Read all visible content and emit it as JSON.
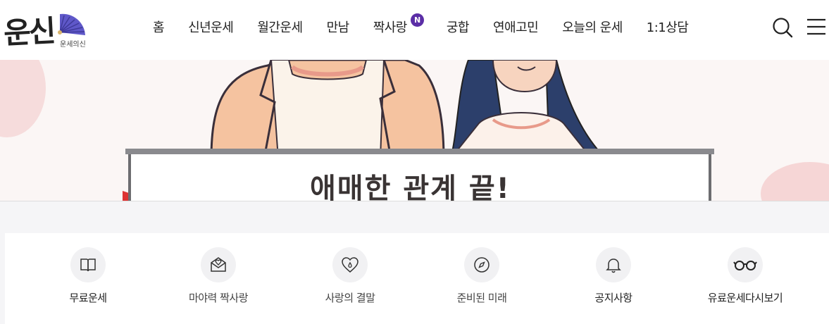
{
  "logo": {
    "main": "운신",
    "sub": "운세의신"
  },
  "nav": {
    "items": [
      {
        "label": "홈"
      },
      {
        "label": "신년운세"
      },
      {
        "label": "월간운세"
      },
      {
        "label": "만남"
      },
      {
        "label": "짝사랑",
        "badge": "N"
      },
      {
        "label": "궁합"
      },
      {
        "label": "연애고민"
      },
      {
        "label": "오늘의 운세"
      },
      {
        "label": "1:1상담"
      }
    ]
  },
  "header": {
    "search_icon": "search-icon",
    "menu_icon": "hamburger-menu-icon"
  },
  "banner": {
    "title": "애매한 관계 끝!"
  },
  "quick_menu": {
    "items": [
      {
        "label": "무료운세",
        "icon": "book-icon"
      },
      {
        "label": "마야력 짝사랑",
        "icon": "love-letter-icon"
      },
      {
        "label": "사랑의 결말",
        "icon": "heart-drop-icon"
      },
      {
        "label": "준비된 미래",
        "icon": "compass-icon"
      },
      {
        "label": "공지사항",
        "icon": "bell-icon"
      },
      {
        "label": "유료운세다시보기",
        "icon": "glasses-icon"
      }
    ]
  },
  "colors": {
    "badge": "#5b2ea6",
    "icon_bg": "#f1f1f3",
    "banner_bg": "#fbf6f5",
    "page_bg": "#f5f5f7"
  }
}
